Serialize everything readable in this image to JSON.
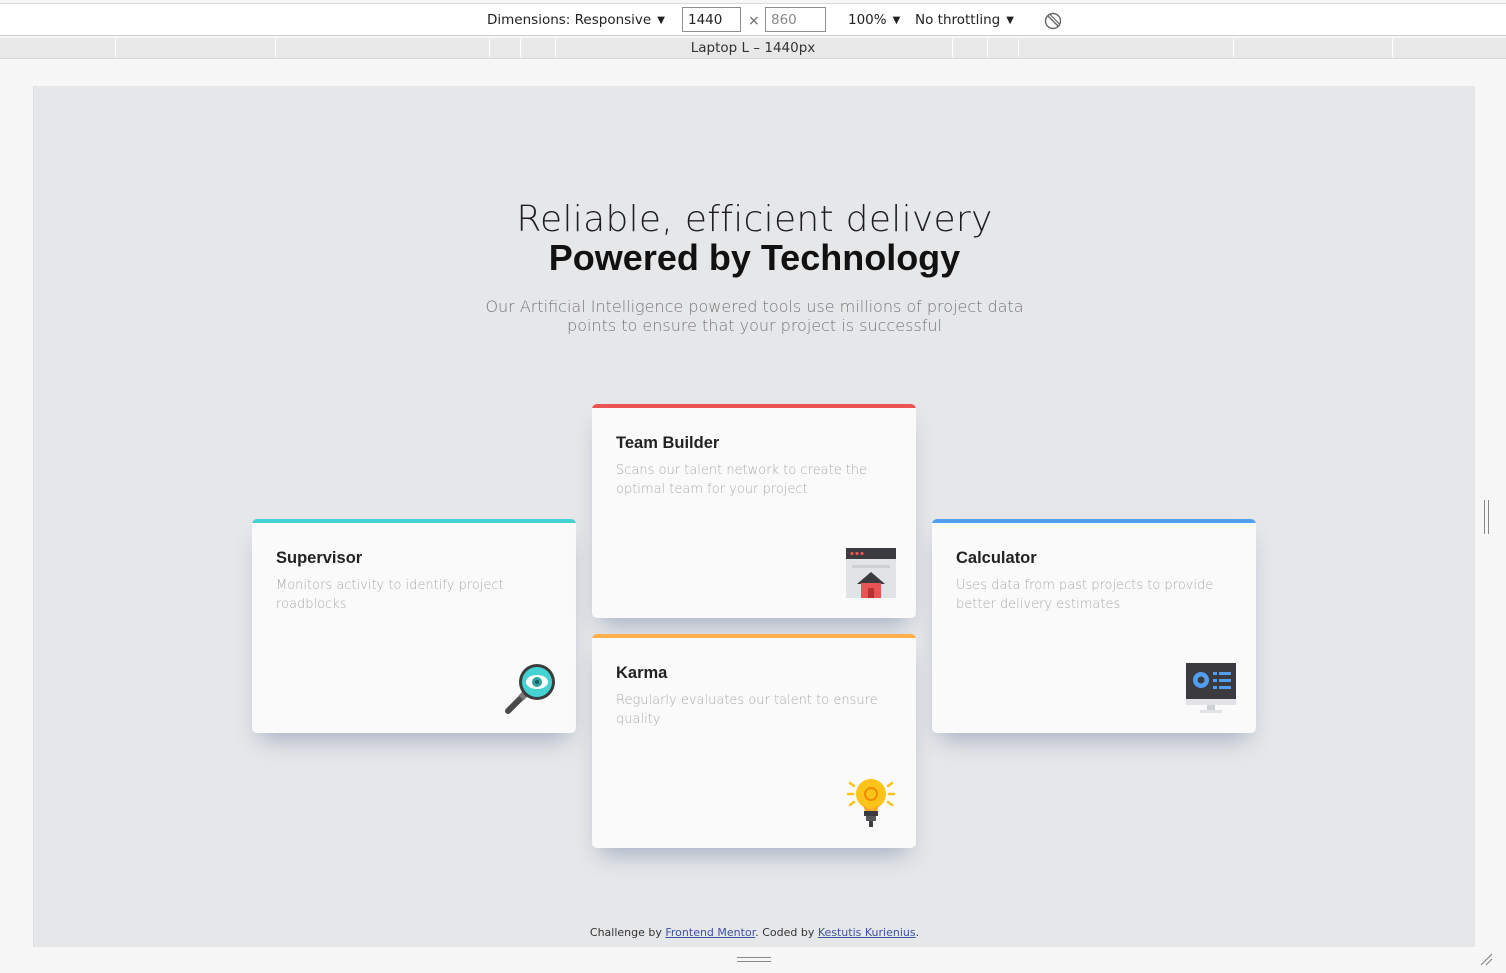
{
  "devtools": {
    "dimensions_label": "Dimensions: Responsive",
    "width_value": "1440",
    "height_value": "860",
    "times": "×",
    "zoom": "100%",
    "throttling": "No throttling",
    "media_query_label": "Laptop L – 1440px"
  },
  "hero": {
    "headline": "Reliable, efficient delivery",
    "headline_strong": "Powered by Technology",
    "intro": "Our Artificial Intelligence powered tools use millions of project data points to ensure that your project is successful"
  },
  "cards": {
    "supervisor": {
      "title": "Supervisor",
      "desc": "Monitors activity to identify project roadblocks",
      "accent": "#44d3d2",
      "icon": "magnifier-eye-icon"
    },
    "team_builder": {
      "title": "Team Builder",
      "desc": "Scans our talent network to create the optimal team for your project",
      "accent": "#ea5454",
      "icon": "browser-home-icon"
    },
    "karma": {
      "title": "Karma",
      "desc": "Regularly evaluates our talent to ensure quality",
      "accent": "#fcaf4a",
      "icon": "lightbulb-icon"
    },
    "calculator": {
      "title": "Calculator",
      "desc": "Uses data from past projects to provide better delivery estimates",
      "accent": "#549ef2",
      "icon": "monitor-chart-icon"
    }
  },
  "footer": {
    "prefix": "Challenge by ",
    "link1": "Frontend Mentor",
    "middle": ". Coded by ",
    "link2": "Kestutis Kurienius",
    "suffix": "."
  }
}
